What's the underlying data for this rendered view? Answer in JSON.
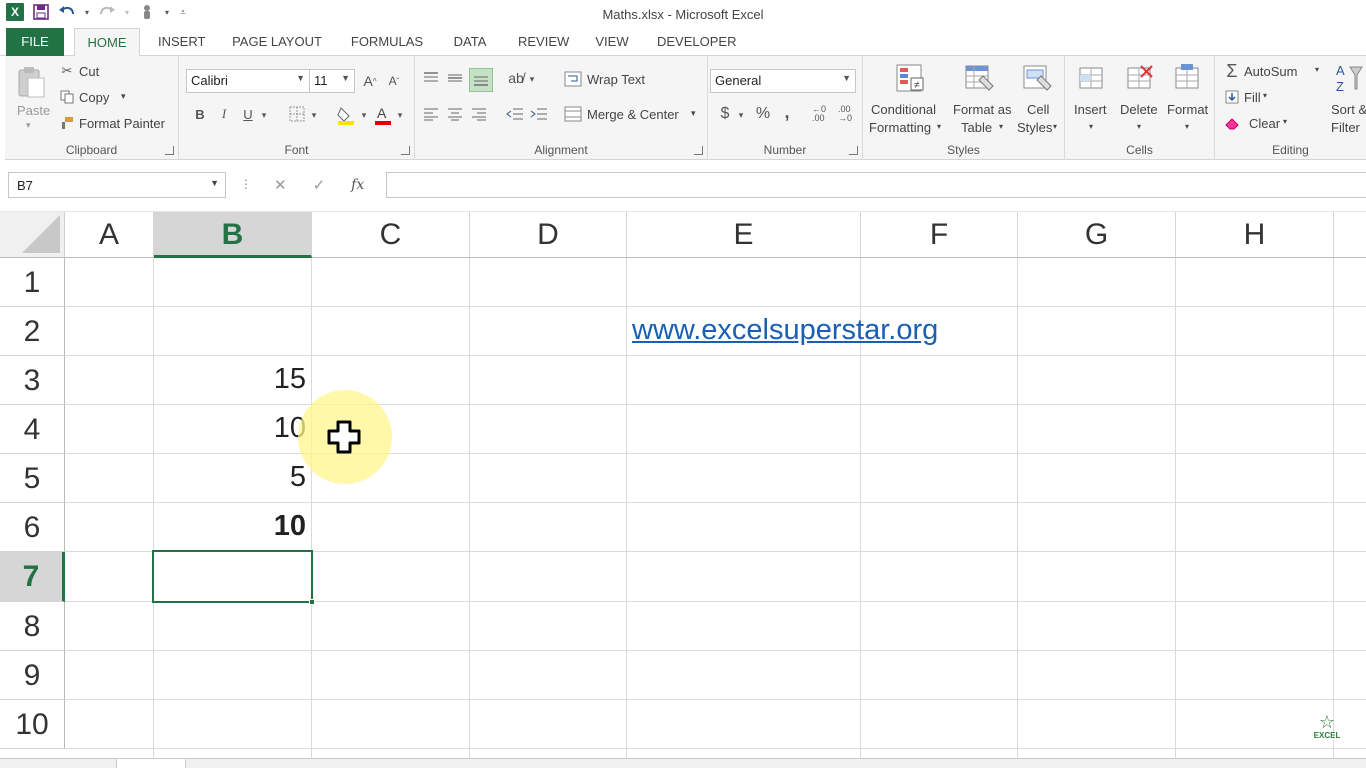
{
  "window": {
    "title": "Maths.xlsx - Microsoft Excel"
  },
  "tabs": [
    "FILE",
    "HOME",
    "INSERT",
    "PAGE LAYOUT",
    "FORMULAS",
    "DATA",
    "REVIEW",
    "VIEW",
    "DEVELOPER"
  ],
  "ribbon": {
    "clipboard": {
      "paste": "Paste",
      "cut": "Cut",
      "copy": "Copy",
      "format_painter": "Format Painter",
      "label": "Clipboard"
    },
    "font": {
      "name": "Calibri",
      "size": "11",
      "bold": "B",
      "italic": "I",
      "underline": "U",
      "label": "Font"
    },
    "alignment": {
      "wrap": "Wrap Text",
      "merge": "Merge & Center",
      "label": "Alignment"
    },
    "number": {
      "format": "General",
      "currency": "$",
      "percent": "%",
      "comma": ",",
      "label": "Number"
    },
    "styles": {
      "conditional_1": "Conditional",
      "conditional_2": "Formatting",
      "table_1": "Format as",
      "table_2": "Table",
      "cell_1": "Cell",
      "cell_2": "Styles",
      "label": "Styles"
    },
    "cells": {
      "insert": "Insert",
      "delete": "Delete",
      "format": "Format",
      "label": "Cells"
    },
    "editing": {
      "autosum": "AutoSum",
      "fill": "Fill",
      "clear": "Clear",
      "sort_1": "Sort &",
      "sort_2": "Filter",
      "label": "Editing"
    }
  },
  "formula_bar": {
    "name_box": "B7",
    "fx": "fx",
    "cancel": "✕",
    "enter": "✓",
    "value": ""
  },
  "sheet": {
    "columns": [
      "A",
      "B",
      "C",
      "D",
      "E",
      "F",
      "G",
      "H"
    ],
    "rows": [
      "1",
      "2",
      "3",
      "4",
      "5",
      "6",
      "7",
      "8",
      "9",
      "10"
    ],
    "cells": {
      "B3": "15",
      "B4": "10",
      "B5": "5",
      "B6": "10",
      "E2": "www.excelsuperstar.org"
    },
    "selected_cell": "B7",
    "selected_column": "B",
    "selected_row": "7"
  },
  "logo": {
    "text": "EXCEL"
  },
  "icons": [
    "excel-logo-icon",
    "save-icon",
    "undo-icon",
    "redo-icon",
    "touch-mode-icon",
    "cut-icon",
    "copy-icon",
    "format-painter-icon",
    "plus-cursor-icon"
  ]
}
